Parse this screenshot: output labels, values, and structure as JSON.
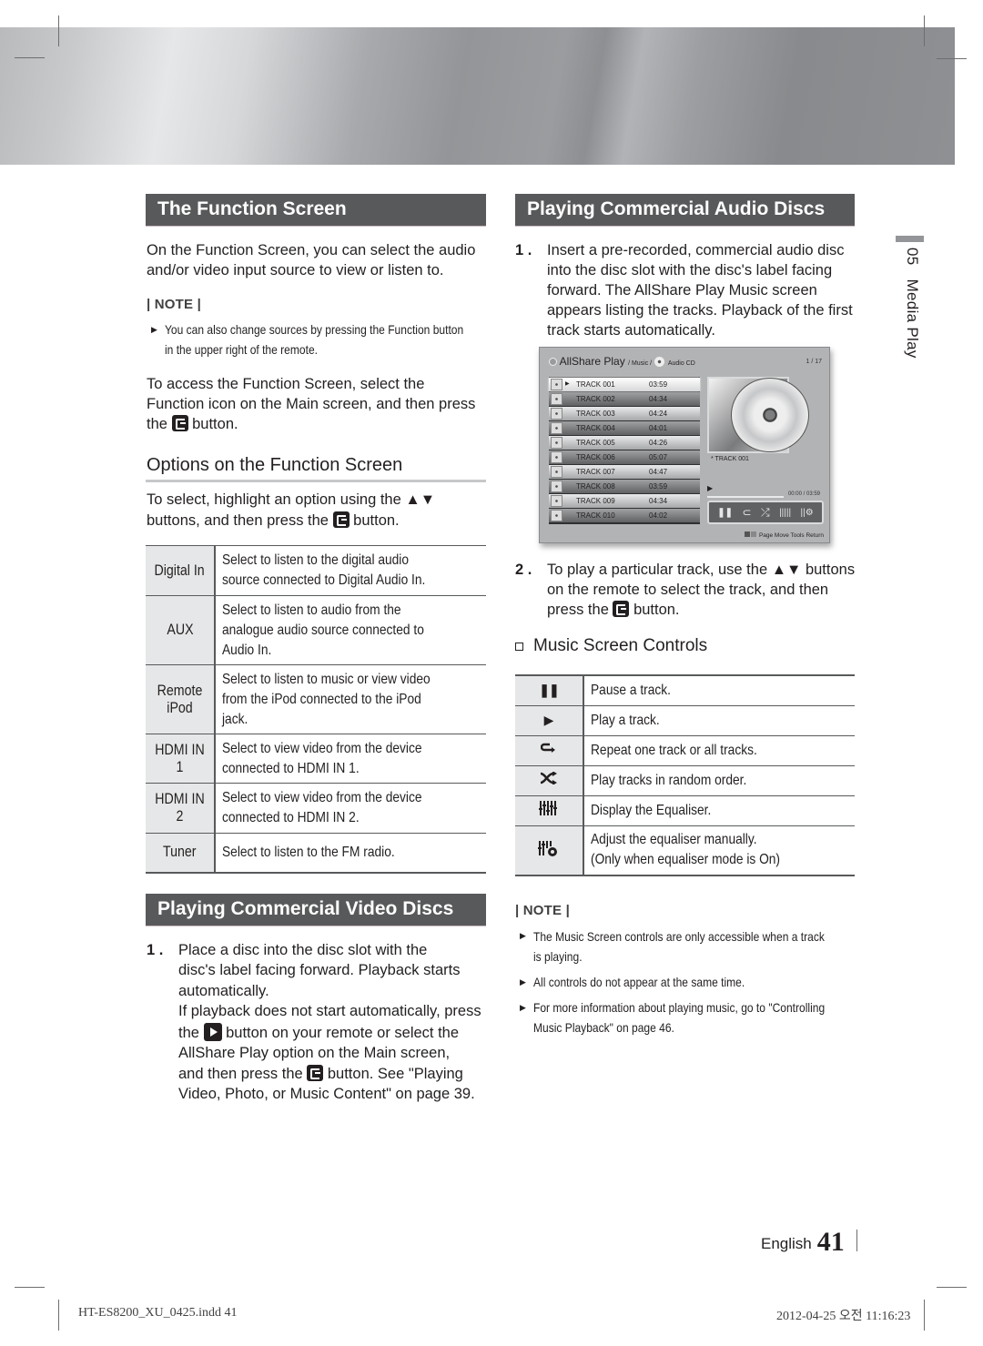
{
  "side_tab": {
    "chapter": "05",
    "title": "Media Play"
  },
  "left": {
    "function_screen": {
      "title": "The Function Screen",
      "intro": [
        "On the Function Screen, you can select the audio",
        "and/or video input source to view or listen to."
      ],
      "note_label": "| NOTE |",
      "note_items": [
        [
          "You can also change sources by pressing the Function button",
          "in the upper right of the remote."
        ]
      ],
      "access_lines": [
        "To access the Function Screen, select the",
        "Function icon on the Main screen, and then press"
      ],
      "access_the": "the",
      "access_button": "button.",
      "options_title": "Options on the Function Screen",
      "options_line1": "To select, highlight an option using the ▲▼",
      "options_line2a": "buttons, and then press the",
      "options_line2b": "button.",
      "table": [
        {
          "key": "Digital In",
          "value": "Select to listen to the digital audio source connected to Digital Audio In."
        },
        {
          "key": "AUX",
          "value": "Select to listen to audio from the analogue audio source connected to Audio In."
        },
        {
          "key": "Remote iPod",
          "value": "Select to listen to music or view video from the iPod connected to the iPod jack."
        },
        {
          "key": "HDMI IN 1",
          "value": "Select to view video from the device connected to HDMI IN 1."
        },
        {
          "key": "HDMI IN 2",
          "value": "Select to view video from the device connected to HDMI IN 2."
        },
        {
          "key": "Tuner",
          "value": "Select to listen to the FM radio."
        }
      ]
    },
    "video_discs": {
      "title": "Playing Commercial Video Discs",
      "step_no": "1 .",
      "lines": [
        "Place a disc into the disc slot with the",
        "disc's label facing forward. Playback starts",
        "automatically.",
        "If playback does not start automatically, press"
      ],
      "line5a": "the",
      "line5b": "button on your remote or select the",
      "line6": "AllShare Play option on the Main screen,",
      "line7a": "and then press the",
      "line7b": "button. See \"Playing",
      "line8": "Video, Photo, or Music Content\" on page 39."
    }
  },
  "right": {
    "audio_discs": {
      "title": "Playing Commercial Audio Discs",
      "step1_no": "1 .",
      "step1_lines": [
        "Insert a pre-recorded, commercial audio disc",
        "into the disc slot with the disc's label facing",
        "forward. The AllShare Play Music screen",
        "appears listing the tracks. Playback of the first",
        "track starts automatically."
      ],
      "step2_no": "2 .",
      "step2_line1": "To play a particular track, use the ▲▼ buttons",
      "step2_line2": "on the remote to select the track, and then",
      "step2_line3a": "press the",
      "step2_line3b": "button."
    },
    "screen": {
      "app": "AllShare Play",
      "path1": "/ Music /",
      "path2": "Audio CD",
      "page": "1 / 17",
      "tracks": [
        {
          "name": "TRACK 001",
          "time": "03:59"
        },
        {
          "name": "TRACK 002",
          "time": "04:34"
        },
        {
          "name": "TRACK 003",
          "time": "04:24"
        },
        {
          "name": "TRACK 004",
          "time": "04:01"
        },
        {
          "name": "TRACK 005",
          "time": "04:26"
        },
        {
          "name": "TRACK 006",
          "time": "05:07"
        },
        {
          "name": "TRACK 007",
          "time": "04:47"
        },
        {
          "name": "TRACK 008",
          "time": "03:59"
        },
        {
          "name": "TRACK 009",
          "time": "04:34"
        },
        {
          "name": "TRACK 010",
          "time": "04:02"
        }
      ],
      "now_playing": "* TRACK 001",
      "time": "00:00 / 03:59",
      "progress": 0,
      "footer": "Page Move   Tools   Return",
      "footer_keys": "B C"
    },
    "controls": {
      "title": "Music Screen Controls",
      "rows": [
        {
          "icon": "pause-icon",
          "text": [
            "Pause a track."
          ]
        },
        {
          "icon": "play-icon",
          "text": [
            "Play a track."
          ]
        },
        {
          "icon": "repeat-icon",
          "text": [
            "Repeat one track or all tracks."
          ]
        },
        {
          "icon": "shuffle-icon",
          "text": [
            "Play tracks in random order."
          ]
        },
        {
          "icon": "equaliser-icon",
          "text": [
            "Display the Equaliser."
          ]
        },
        {
          "icon": "equaliser-settings-icon",
          "text": [
            "Adjust the equaliser manually.",
            "(Only when equaliser mode is On)"
          ]
        }
      ]
    },
    "note": {
      "label": "| NOTE |",
      "items": [
        [
          "The Music Screen controls are only accessible when a track",
          "is playing."
        ],
        [
          "All controls do not appear at the same time."
        ],
        [
          "For more information about playing music, go to \"Controlling",
          "Music Playback\" on page 46."
        ]
      ]
    }
  },
  "footer": {
    "language": "English",
    "page": "41",
    "slug_file": "HT-ES8200_XU_0425.indd   41",
    "slug_date": "2012-04-25   오전 11:16:23"
  }
}
